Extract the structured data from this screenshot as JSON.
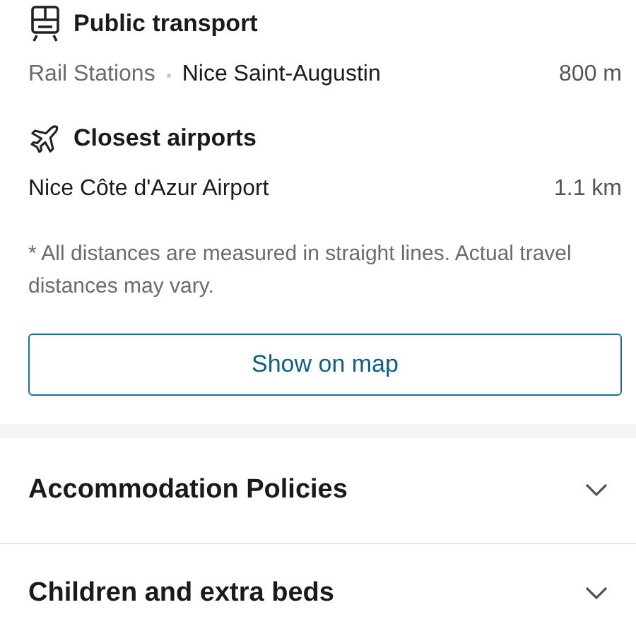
{
  "sections": [
    {
      "kind": "transport",
      "title": "Public transport",
      "items": [
        {
          "category": "Rail Stations",
          "name": "Nice Saint-Augustin",
          "distance": "800 m"
        }
      ]
    },
    {
      "kind": "airport",
      "title": "Closest airports",
      "items": [
        {
          "name": "Nice Côte d'Azur Airport",
          "distance": "1.1 km"
        }
      ]
    }
  ],
  "note": "* All distances are measured in straight lines. Actual travel distances may vary.",
  "map_button": "Show on map",
  "accordions": [
    {
      "title": "Accommodation Policies",
      "expanded": false
    },
    {
      "title": "Children and extra beds",
      "expanded": false
    }
  ]
}
